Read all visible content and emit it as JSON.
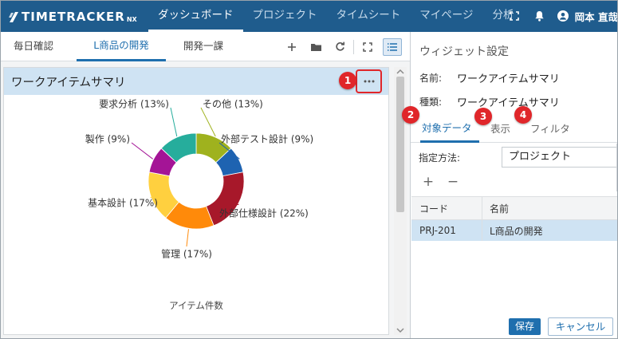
{
  "app": {
    "logo_text": "TIMETRACKER",
    "logo_suffix": "NX"
  },
  "nav": [
    {
      "label": "ダッシュボード",
      "active": true
    },
    {
      "label": "プロジェクト",
      "active": false
    },
    {
      "label": "タイムシート",
      "active": false
    },
    {
      "label": "マイページ",
      "active": false
    },
    {
      "label": "分析",
      "active": false
    }
  ],
  "top_icons": [
    "fullscreen-icon",
    "bell-icon",
    "user-icon"
  ],
  "user": {
    "name": "岡本 直哉"
  },
  "tabs": [
    {
      "label": "毎日確認",
      "active": false
    },
    {
      "label": "L商品の開発",
      "active": true
    },
    {
      "label": "開発一課",
      "active": false
    }
  ],
  "tab_tools": [
    "plus-icon",
    "folder-icon",
    "refresh-icon",
    "fullscreen-icon",
    "list-icon"
  ],
  "widget": {
    "title": "ワークアイテムサマリ",
    "menu_icon": "ellipsis-icon"
  },
  "chart_data": {
    "type": "pie",
    "donut": true,
    "title": "",
    "xlabel": "アイテム件数",
    "slices": [
      {
        "name": "その他",
        "label": "その他 (13%)",
        "percent": 13,
        "color": "#9fb21e"
      },
      {
        "name": "外部テスト設計",
        "label": "外部テスト設計 (9%)",
        "percent": 9,
        "color": "#1e63b1"
      },
      {
        "name": "外部仕様設計",
        "label": "外部仕様設計 (22%)",
        "percent": 22,
        "color": "#a7182a"
      },
      {
        "name": "管理",
        "label": "管理 (17%)",
        "percent": 17,
        "color": "#ff8a0a"
      },
      {
        "name": "基本設計",
        "label": "基本設計 (17%)",
        "percent": 17,
        "color": "#ffd03f"
      },
      {
        "name": "製作",
        "label": "製作 (9%)",
        "percent": 9,
        "color": "#a41496"
      },
      {
        "name": "要求分析",
        "label": "要求分析 (13%)",
        "percent": 13,
        "color": "#26ad9c"
      }
    ]
  },
  "panel": {
    "title": "ウィジェット設定",
    "name_label": "名前:",
    "name_value": "ワークアイテムサマリ",
    "type_label": "種類:",
    "type_value": "ワークアイテムサマリ",
    "tabs": [
      {
        "label": "対象データ",
        "active": true
      },
      {
        "label": "表示",
        "active": false
      },
      {
        "label": "フィルタ",
        "active": false
      }
    ],
    "method_label": "指定方法:",
    "method_value": "プロジェクト",
    "add_symbol": "+",
    "remove_symbol": "−",
    "grid": {
      "columns": [
        "コード",
        "名前"
      ],
      "rows": [
        {
          "code": "PRJ-201",
          "name": "L商品の開発"
        }
      ]
    },
    "save_label": "保存",
    "cancel_label": "キャンセル"
  },
  "badges": [
    "1",
    "2",
    "3",
    "4"
  ],
  "colors": {
    "topbar": "#1f5c8d",
    "accent": "#1f6fae",
    "badge": "#e0262a",
    "selection": "#cfe3f3"
  }
}
